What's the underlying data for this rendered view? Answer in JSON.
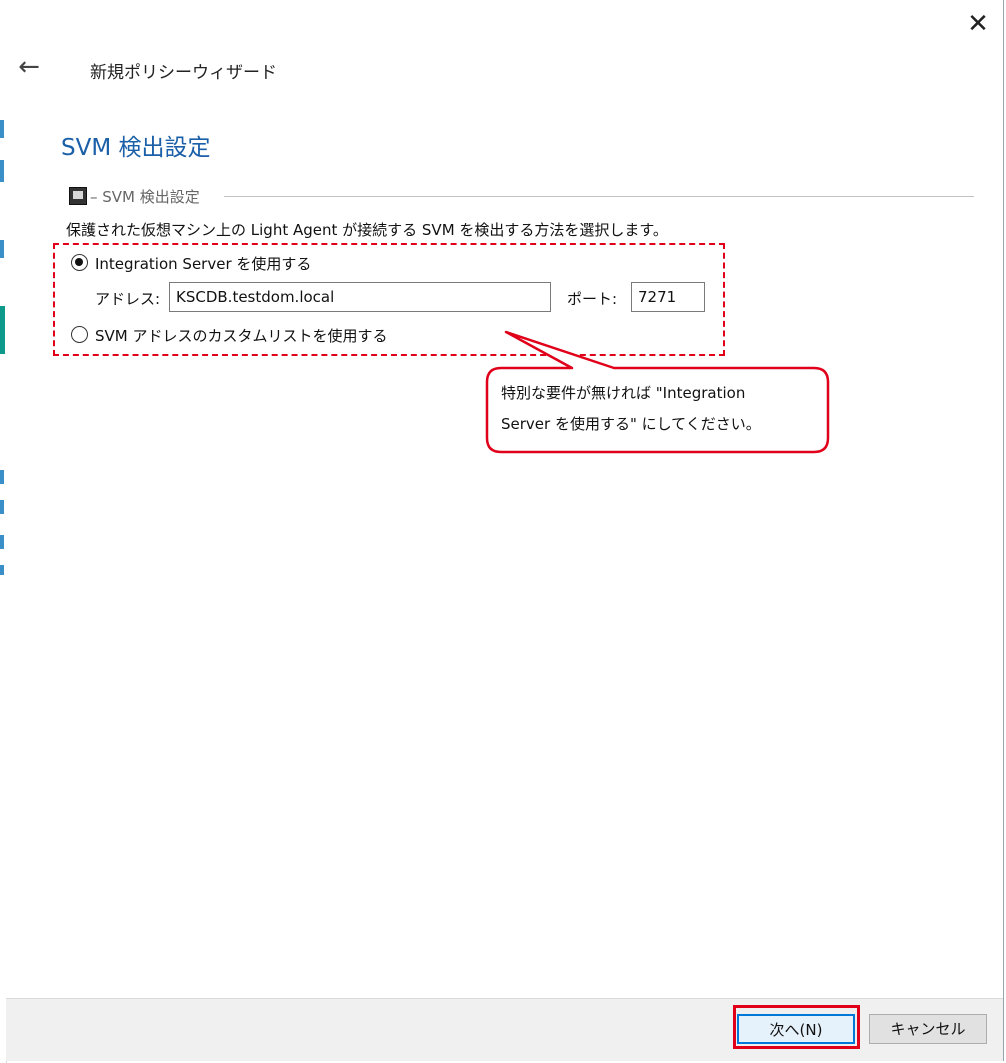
{
  "window": {
    "wizard_title": "新規ポリシーウィザード",
    "close_icon": "close-icon",
    "back_icon": "back-arrow-icon"
  },
  "page": {
    "title": "SVM 検出設定",
    "group_label": "– SVM 検出設定",
    "description": "保護された仮想マシン上の Light Agent が接続する SVM を検出する方法を選択します。"
  },
  "options": {
    "integration_server": {
      "label": "Integration Server を使用する",
      "checked": true
    },
    "address_label": "アドレス:",
    "address_value": "KSCDB.testdom.local",
    "port_label": "ポート:",
    "port_value": "7271",
    "custom_list": {
      "label": "SVM アドレスのカスタムリストを使用する",
      "checked": false
    }
  },
  "callout": {
    "line1": "特別な要件が無ければ \"Integration",
    "line2": "Server を使用する\" にしてください。"
  },
  "footer": {
    "next_label": "次へ(N)",
    "cancel_label": "キャンセル"
  },
  "colors": {
    "accent": "#1a5fa8",
    "highlight": "#e0001a",
    "primary_border": "#0078d7"
  }
}
